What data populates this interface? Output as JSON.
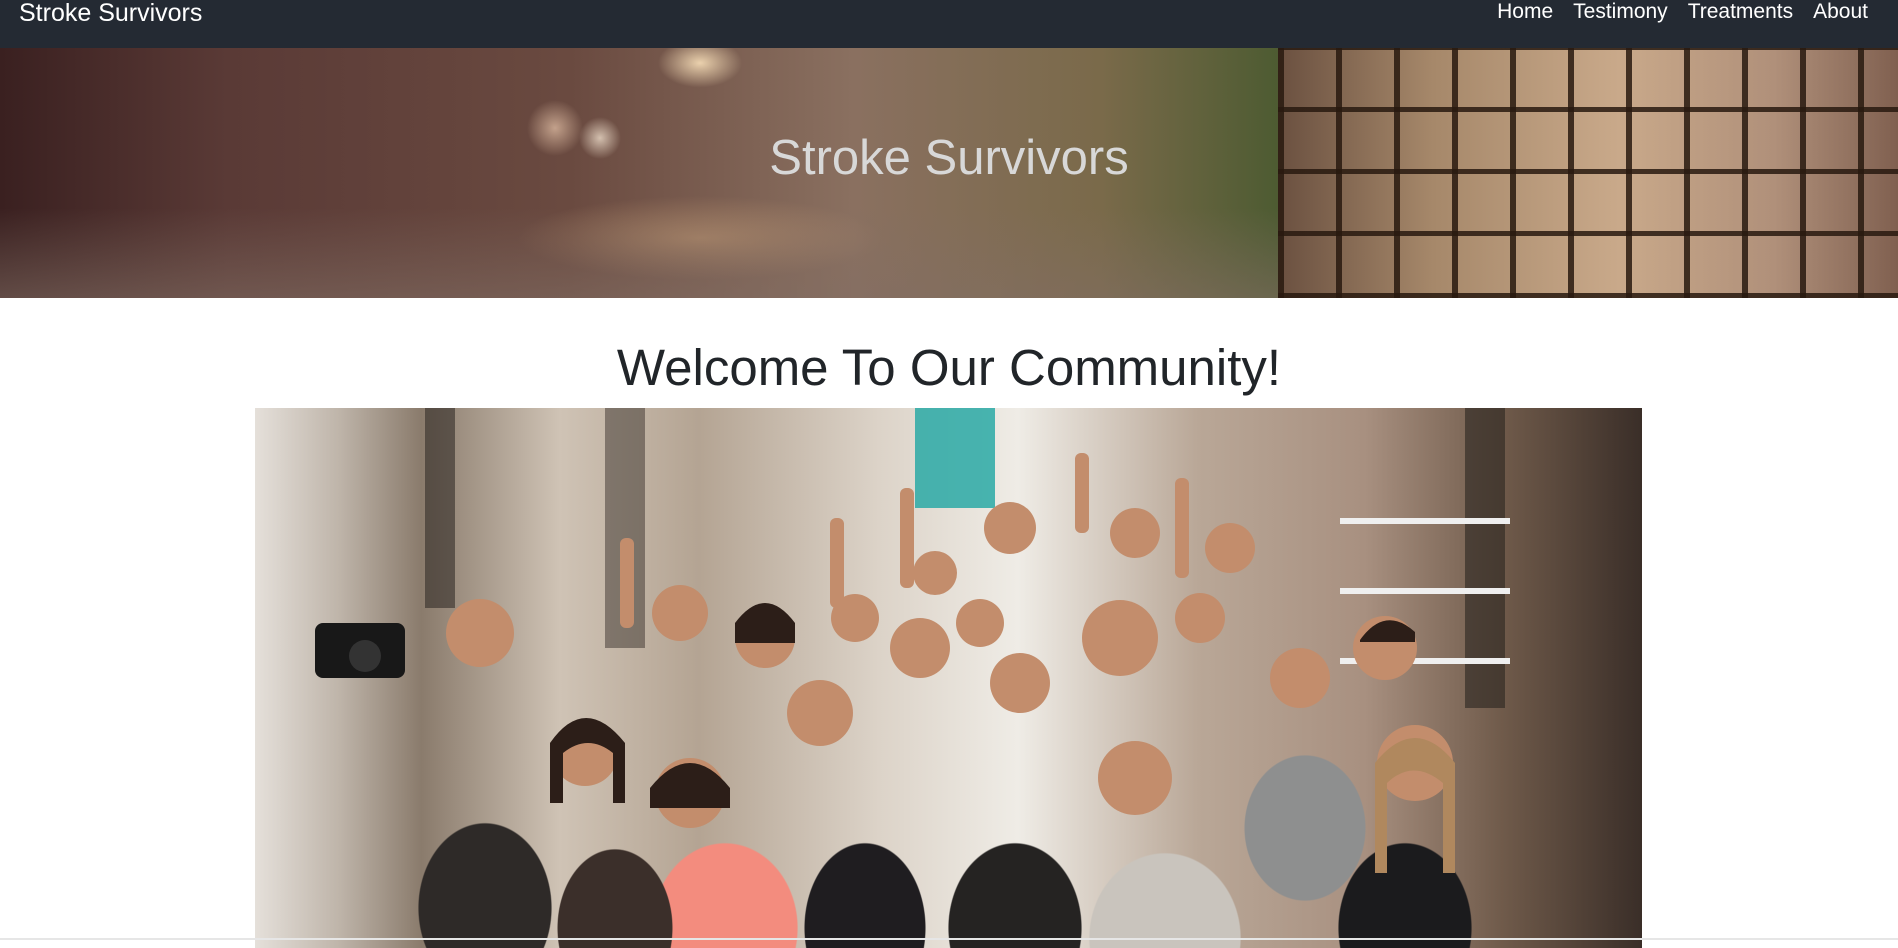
{
  "navbar": {
    "brand": "Stroke Survivors",
    "links": [
      {
        "label": "Home"
      },
      {
        "label": "Testimony"
      },
      {
        "label": "Treatments"
      },
      {
        "label": "About"
      }
    ]
  },
  "hero": {
    "title": "Stroke Survivors"
  },
  "main": {
    "heading": "Welcome To Our Community!"
  },
  "colors": {
    "navbar_bg": "#242a33",
    "nav_text": "#ffffff",
    "heading_text": "#212529",
    "hero_text": "#d8d8d8"
  }
}
